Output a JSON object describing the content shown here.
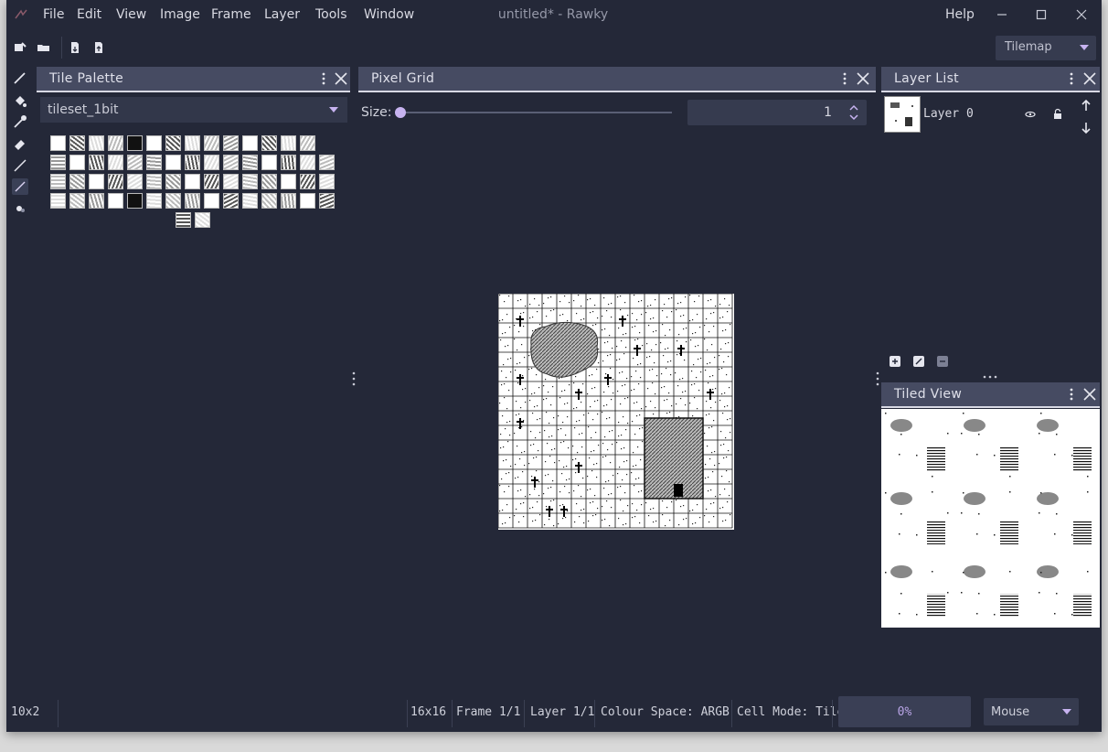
{
  "app": {
    "title": "untitled* - Rawky"
  },
  "menu": [
    "File",
    "Edit",
    "View",
    "Image",
    "Frame",
    "Layer",
    "Tools",
    "Window"
  ],
  "help_menu": "Help",
  "toolbar": {
    "mode": "Tilemap"
  },
  "tile_palette": {
    "title": "Tile Palette",
    "tileset": "tileset_1bit",
    "rows": [
      14,
      15,
      15,
      15,
      2
    ]
  },
  "pixel_grid": {
    "title": "Pixel Grid",
    "size_label": "Size:",
    "size_value": "1"
  },
  "layer_list": {
    "title": "Layer List",
    "layers": [
      {
        "name": "Layer 0"
      }
    ]
  },
  "tiled_view": {
    "title": "Tiled View"
  },
  "status": {
    "selection": "10x2",
    "canvas_size": "16x16",
    "frame": "Frame 1/1",
    "layer": "Layer 1/1",
    "colour_space": "Colour Space: ARGB",
    "cell_mode": "Cell Mode: Tile",
    "progress": "0%",
    "progress_value": 0,
    "input_mode": "Mouse"
  },
  "colors": {
    "accent": "#c7b3f0",
    "background": "#242838",
    "panel_header": "#464b62"
  }
}
